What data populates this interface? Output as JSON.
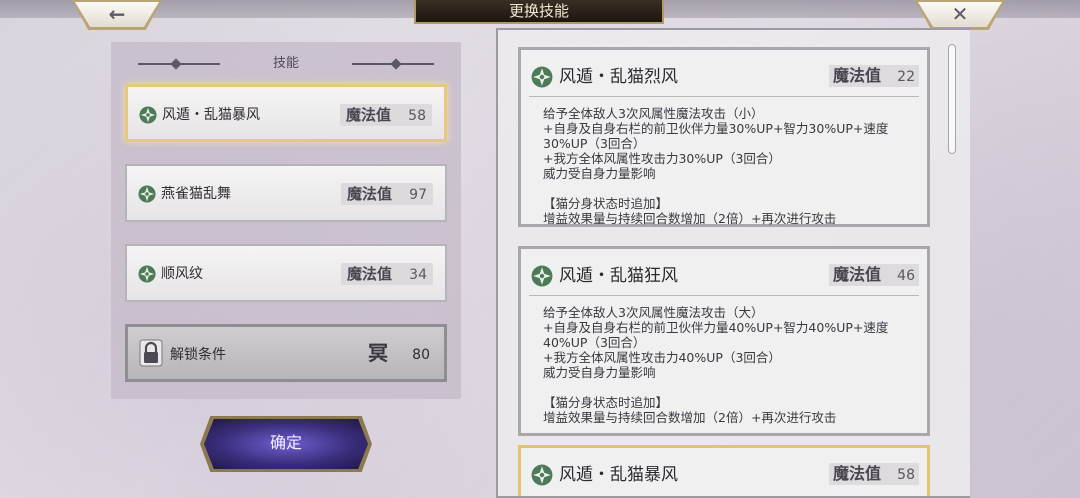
{
  "header": {
    "title": "更换技能",
    "back_glyph": "←",
    "close_glyph": "✕"
  },
  "left_panel": {
    "heading": "技能",
    "slots": [
      {
        "name": "风遁・乱猫暴风",
        "mp_label": "魔法值",
        "mp": "58",
        "selected": true
      },
      {
        "name": "燕雀猫乱舞",
        "mp_label": "魔法值",
        "mp": "97",
        "selected": false
      },
      {
        "name": "顺风纹",
        "mp_label": "魔法值",
        "mp": "34",
        "selected": false
      }
    ],
    "locked_slot": {
      "label": "解锁条件",
      "cost_glyph": "冥",
      "cost": "80"
    }
  },
  "confirm_label": "确定",
  "skill_list": [
    {
      "name": "风遁・乱猫烈风",
      "mp_label": "魔法值",
      "mp": "22",
      "lines": [
        "给予全体敌人3次风属性魔法攻击（小）",
        "+自身及自身右栏的前卫伙伴力量30%UP+智力30%UP+速度",
        "30%UP（3回合）",
        "+我方全体风属性攻击力30%UP（3回合）",
        "威力受自身力量影响",
        "",
        "【猫分身状态时追加】",
        "增益效果量与持续回合数增加（2倍）+再次进行攻击"
      ]
    },
    {
      "name": "风遁・乱猫狂风",
      "mp_label": "魔法值",
      "mp": "46",
      "lines": [
        "给予全体敌人3次风属性魔法攻击（大）",
        "+自身及自身右栏的前卫伙伴力量40%UP+智力40%UP+速度",
        "40%UP（3回合）",
        "+我方全体风属性攻击力40%UP（3回合）",
        "威力受自身力量影响",
        "",
        "【猫分身状态时追加】",
        "增益效果量与持续回合数增加（2倍）+再次进行攻击"
      ]
    },
    {
      "name": "风遁・乱猫暴风",
      "mp_label": "魔法值",
      "mp": "58",
      "lines": []
    }
  ],
  "colors": {
    "accent_gold": "#e2c46e",
    "wind_icon": "#4d7a58",
    "confirm_purple": "#3b2f7e"
  },
  "icons": {
    "skill": "wind-emblem-icon",
    "lock": "padlock-icon"
  }
}
